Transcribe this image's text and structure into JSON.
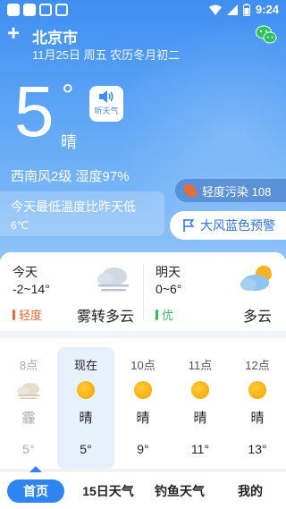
{
  "status_bar": {
    "time": "9:24"
  },
  "header": {
    "city": "北京市",
    "date": "11月25日 周五 农历冬月初二"
  },
  "current": {
    "temperature": "5",
    "degree_symbol": "°",
    "condition": "晴",
    "listen_label": "听天气",
    "wind_humidity": "西南风2级 湿度97%",
    "compare_line1": "今天最低温度比昨天低",
    "compare_line2": "6℃",
    "aqi_label": "轻度污染 108",
    "alert_label": "大风蓝色预警"
  },
  "forecast": {
    "today": {
      "label": "今天",
      "range": "-2~14°",
      "air_quality": "轻度",
      "air_color": "#e96b35",
      "condition": "雾转多云"
    },
    "tomorrow": {
      "label": "明天",
      "range": "0~6°",
      "air_quality": "优",
      "air_color": "#2fbf5a",
      "condition": "多云"
    }
  },
  "hourly": [
    {
      "time": "8点",
      "condition": "霾",
      "temp": "5°",
      "icon": "haze-icon"
    },
    {
      "time": "现在",
      "condition": "晴",
      "temp": "5°",
      "icon": "sun-icon"
    },
    {
      "time": "10点",
      "condition": "晴",
      "temp": "9°",
      "icon": "sun-icon"
    },
    {
      "time": "11点",
      "condition": "晴",
      "temp": "11°",
      "icon": "sun-icon"
    },
    {
      "time": "12点",
      "condition": "晴",
      "temp": "13°",
      "icon": "sun-icon"
    }
  ],
  "nav": {
    "home": "首页",
    "fifteen_day": "15日天气",
    "fishing": "钓鱼天气",
    "mine": "我的"
  },
  "colors": {
    "accent": "#2d86f0",
    "sky_top": "#3f8ff2",
    "pollution": "#e96b35",
    "good": "#2fbf5a"
  }
}
